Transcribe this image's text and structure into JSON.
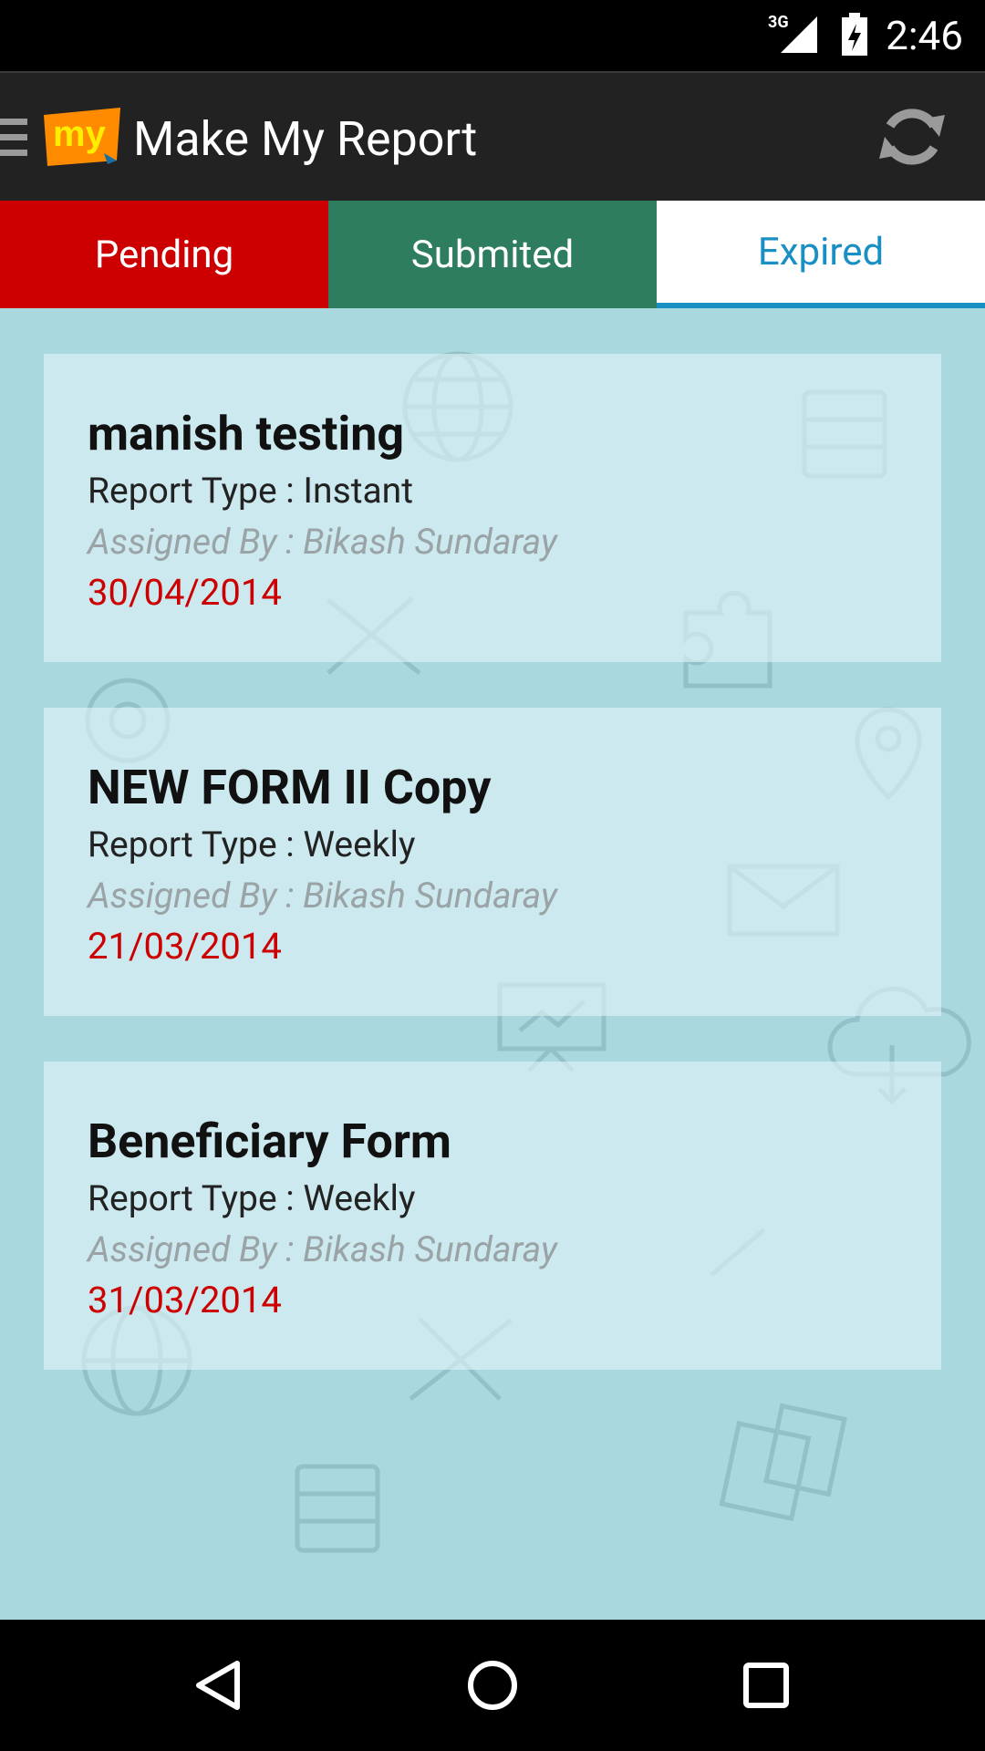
{
  "status_bar": {
    "time": "2:46",
    "network": "3G"
  },
  "app_bar": {
    "logo_text": "my",
    "title": "Make My Report",
    "brand_color": "#ff8c00",
    "refresh_icon": "refresh-icon",
    "menu_icon": "menu-icon"
  },
  "tabs": [
    {
      "label": "Pending",
      "color": "#cc0000",
      "selected": false
    },
    {
      "label": "Submited",
      "color": "#2e7d5f",
      "selected": false
    },
    {
      "label": "Expired",
      "color": "#1a8fc4",
      "selected": true
    }
  ],
  "reports": [
    {
      "title": "manish testing",
      "report_type": "Report Type : Instant",
      "assigned_by": "Assigned By : Bikash Sundaray",
      "date": "30/04/2014"
    },
    {
      "title": "NEW FORM II Copy",
      "report_type": "Report Type : Weekly",
      "assigned_by": "Assigned By : Bikash Sundaray",
      "date": "21/03/2014"
    },
    {
      "title": "Beneficiary Form",
      "report_type": "Report Type : Weekly",
      "assigned_by": "Assigned By : Bikash Sundaray",
      "date": "31/03/2014"
    }
  ],
  "nav_bar": {
    "back_icon": "back-icon",
    "home_icon": "home-icon",
    "recents_icon": "recents-icon"
  }
}
